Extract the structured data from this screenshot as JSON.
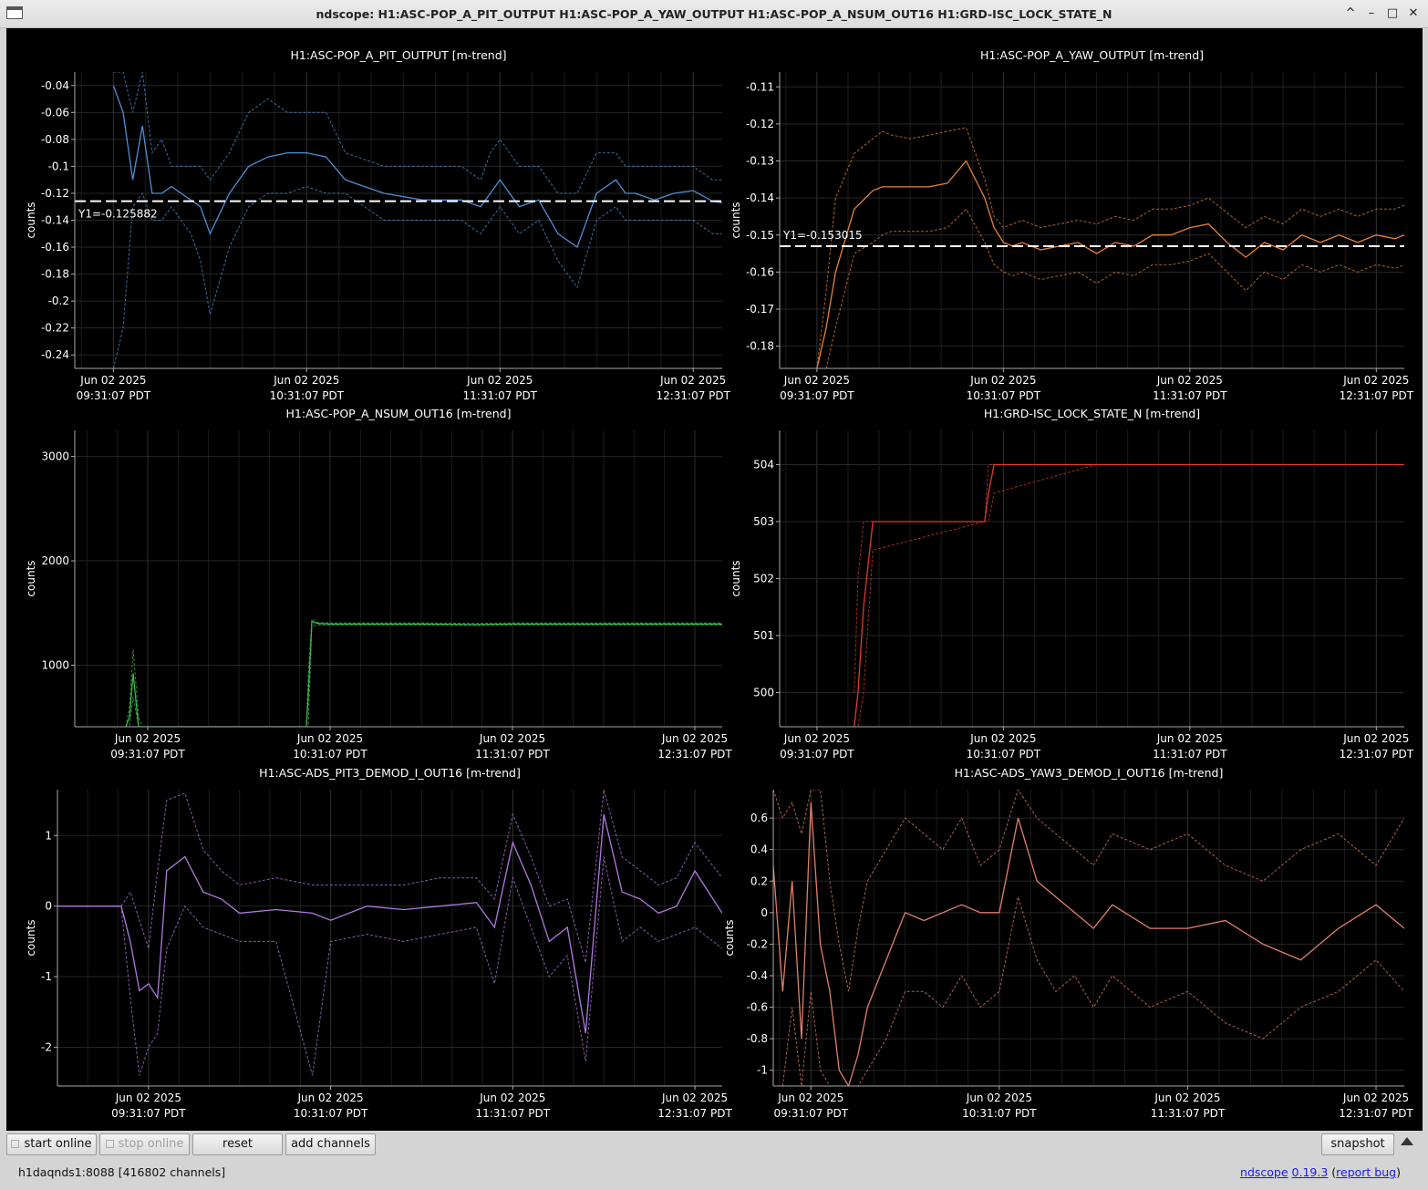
{
  "window": {
    "title": "ndscope: H1:ASC-POP_A_PIT_OUTPUT H1:ASC-POP_A_YAW_OUTPUT H1:ASC-POP_A_NSUM_OUT16 H1:GRD-ISC_LOCK_STATE_N",
    "controls": [
      "^",
      "–",
      "□",
      "✕"
    ]
  },
  "x_ticks": {
    "date_line": "Jun 02 2025",
    "time_lines": [
      "09:31:07 PDT",
      "10:31:07 PDT",
      "11:31:07 PDT",
      "12:31:07 PDT"
    ]
  },
  "chart_data": [
    {
      "type": "line",
      "title": "H1:ASC-POP_A_PIT_OUTPUT [m-trend]",
      "ylabel": "counts",
      "ylim": [
        -0.25,
        -0.03
      ],
      "yticks": [
        -0.04,
        -0.06,
        -0.08,
        -0.1,
        -0.12,
        -0.14,
        -0.16,
        -0.18,
        -0.2,
        -0.22,
        -0.24
      ],
      "xlim": [
        -0.2,
        3.15
      ],
      "color": "#4f8fd6",
      "cursor": {
        "y": -0.125882,
        "label": "Y1=-0.125882"
      },
      "x": [
        0,
        0.05,
        0.1,
        0.15,
        0.2,
        0.25,
        0.3,
        0.35,
        0.4,
        0.45,
        0.5,
        0.6,
        0.7,
        0.8,
        0.9,
        1.0,
        1.1,
        1.2,
        1.4,
        1.6,
        1.8,
        1.9,
        1.95,
        2.0,
        2.1,
        2.2,
        2.3,
        2.4,
        2.5,
        2.6,
        2.65,
        2.7,
        2.8,
        2.9,
        3.0,
        3.1,
        3.15
      ],
      "mean": [
        -0.04,
        -0.06,
        -0.11,
        -0.07,
        -0.12,
        -0.12,
        -0.115,
        -0.12,
        -0.125,
        -0.13,
        -0.15,
        -0.12,
        -0.1,
        -0.093,
        -0.09,
        -0.09,
        -0.093,
        -0.11,
        -0.12,
        -0.125,
        -0.125,
        -0.13,
        -0.12,
        -0.11,
        -0.13,
        -0.125,
        -0.15,
        -0.16,
        -0.12,
        -0.11,
        -0.12,
        -0.12,
        -0.125,
        -0.12,
        -0.118,
        -0.126,
        -0.127
      ],
      "max": [
        -0.03,
        -0.03,
        -0.06,
        -0.03,
        -0.09,
        -0.08,
        -0.1,
        -0.1,
        -0.1,
        -0.1,
        -0.11,
        -0.09,
        -0.06,
        -0.05,
        -0.06,
        -0.06,
        -0.06,
        -0.09,
        -0.1,
        -0.1,
        -0.1,
        -0.11,
        -0.09,
        -0.08,
        -0.1,
        -0.1,
        -0.12,
        -0.12,
        -0.09,
        -0.09,
        -0.1,
        -0.1,
        -0.1,
        -0.1,
        -0.1,
        -0.11,
        -0.11
      ],
      "min": [
        -0.25,
        -0.22,
        -0.13,
        -0.12,
        -0.14,
        -0.14,
        -0.13,
        -0.14,
        -0.15,
        -0.17,
        -0.21,
        -0.16,
        -0.13,
        -0.12,
        -0.12,
        -0.115,
        -0.12,
        -0.12,
        -0.14,
        -0.14,
        -0.14,
        -0.15,
        -0.14,
        -0.13,
        -0.15,
        -0.14,
        -0.17,
        -0.19,
        -0.14,
        -0.13,
        -0.14,
        -0.14,
        -0.14,
        -0.14,
        -0.14,
        -0.15,
        -0.15
      ]
    },
    {
      "type": "line",
      "title": "H1:ASC-POP_A_YAW_OUTPUT [m-trend]",
      "ylabel": "counts",
      "ylim": [
        -0.186,
        -0.106
      ],
      "yticks": [
        -0.11,
        -0.12,
        -0.13,
        -0.14,
        -0.15,
        -0.16,
        -0.17,
        -0.18
      ],
      "xlim": [
        -0.2,
        3.15
      ],
      "color": "#e8813a",
      "cursor": {
        "y": -0.153015,
        "label": "Y1=-0.153015"
      },
      "x": [
        0,
        0.05,
        0.1,
        0.2,
        0.3,
        0.35,
        0.4,
        0.5,
        0.6,
        0.7,
        0.8,
        0.9,
        0.95,
        1.0,
        1.05,
        1.1,
        1.2,
        1.3,
        1.4,
        1.5,
        1.6,
        1.7,
        1.8,
        1.9,
        2.0,
        2.1,
        2.2,
        2.3,
        2.4,
        2.5,
        2.6,
        2.7,
        2.8,
        2.9,
        3.0,
        3.1,
        3.15
      ],
      "mean": [
        -0.186,
        -0.175,
        -0.16,
        -0.143,
        -0.138,
        -0.137,
        -0.137,
        -0.137,
        -0.137,
        -0.136,
        -0.13,
        -0.14,
        -0.148,
        -0.152,
        -0.153,
        -0.152,
        -0.154,
        -0.153,
        -0.152,
        -0.155,
        -0.152,
        -0.153,
        -0.15,
        -0.15,
        -0.148,
        -0.147,
        -0.152,
        -0.156,
        -0.152,
        -0.154,
        -0.15,
        -0.152,
        -0.15,
        -0.152,
        -0.15,
        -0.151,
        -0.15
      ],
      "max": [
        -0.186,
        -0.165,
        -0.14,
        -0.128,
        -0.124,
        -0.122,
        -0.123,
        -0.124,
        -0.123,
        -0.122,
        -0.121,
        -0.135,
        -0.145,
        -0.148,
        -0.147,
        -0.146,
        -0.148,
        -0.147,
        -0.146,
        -0.147,
        -0.145,
        -0.146,
        -0.143,
        -0.143,
        -0.142,
        -0.14,
        -0.144,
        -0.148,
        -0.145,
        -0.147,
        -0.143,
        -0.145,
        -0.143,
        -0.145,
        -0.143,
        -0.143,
        -0.142
      ],
      "min": [
        -0.186,
        -0.186,
        -0.175,
        -0.155,
        -0.152,
        -0.15,
        -0.149,
        -0.149,
        -0.149,
        -0.148,
        -0.143,
        -0.152,
        -0.158,
        -0.16,
        -0.161,
        -0.16,
        -0.162,
        -0.161,
        -0.16,
        -0.163,
        -0.16,
        -0.161,
        -0.158,
        -0.158,
        -0.157,
        -0.155,
        -0.16,
        -0.165,
        -0.16,
        -0.162,
        -0.158,
        -0.16,
        -0.158,
        -0.16,
        -0.158,
        -0.159,
        -0.158
      ]
    },
    {
      "type": "line",
      "title": "H1:ASC-POP_A_NSUM_OUT16 [m-trend]",
      "ylabel": "counts",
      "ylim": [
        410,
        3250
      ],
      "yticks": [
        1000,
        2000,
        3000
      ],
      "xlim": [
        -0.4,
        3.15
      ],
      "color": "#3fb34f",
      "x": [
        -0.12,
        -0.1,
        -0.08,
        -0.05,
        -0.03,
        0.87,
        0.88,
        0.9,
        0.93,
        1.0,
        1.2,
        1.5,
        1.8,
        2.0,
        2.3,
        2.6,
        2.9,
        3.15
      ],
      "mean": [
        410,
        500,
        920,
        410,
        410,
        410,
        700,
        1420,
        1400,
        1395,
        1395,
        1395,
        1390,
        1395,
        1395,
        1395,
        1395,
        1395
      ],
      "max": [
        410,
        600,
        1150,
        500,
        410,
        410,
        900,
        1440,
        1410,
        1405,
        1405,
        1405,
        1400,
        1405,
        1405,
        1405,
        1405,
        1405
      ],
      "min": [
        410,
        410,
        700,
        410,
        410,
        410,
        410,
        1380,
        1385,
        1385,
        1385,
        1385,
        1380,
        1385,
        1385,
        1385,
        1385,
        1385
      ]
    },
    {
      "type": "line",
      "title": "H1:GRD-ISC_LOCK_STATE_N [m-trend]",
      "ylabel": "counts",
      "ylim": [
        499.4,
        504.6
      ],
      "yticks": [
        500,
        501,
        502,
        503,
        504
      ],
      "xlim": [
        -0.2,
        3.15
      ],
      "color": "#e03a2e",
      "x": [
        0.2,
        0.22,
        0.25,
        0.3,
        0.9,
        0.92,
        0.95,
        1.5,
        2.0,
        2.5,
        3.15
      ],
      "mean": [
        499.4,
        500,
        501.5,
        503,
        503,
        503.5,
        504,
        504,
        504,
        504,
        504
      ],
      "max": [
        500,
        502,
        503,
        503,
        503,
        504,
        504,
        504,
        504,
        504,
        504
      ],
      "min": [
        499.4,
        499.4,
        500,
        502.5,
        503,
        503,
        503.5,
        504,
        504,
        504,
        504
      ]
    },
    {
      "type": "line",
      "title": "H1:ASC-ADS_PIT3_DEMOD_I_OUT16 [m-trend]",
      "ylabel": "counts",
      "ylim": [
        -2.55,
        1.65
      ],
      "yticks": [
        1,
        0,
        -1,
        -2
      ],
      "xlim": [
        -0.5,
        3.15
      ],
      "color": "#b07ae0",
      "x": [
        -0.5,
        -0.15,
        -0.1,
        -0.05,
        0,
        0.05,
        0.1,
        0.2,
        0.3,
        0.4,
        0.5,
        0.7,
        0.9,
        1.0,
        1.2,
        1.4,
        1.6,
        1.8,
        1.9,
        2.0,
        2.1,
        2.2,
        2.3,
        2.4,
        2.5,
        2.6,
        2.7,
        2.8,
        2.9,
        3.0,
        3.15
      ],
      "mean": [
        0,
        0,
        -0.5,
        -1.2,
        -1.1,
        -1.3,
        0.5,
        0.7,
        0.2,
        0.1,
        -0.1,
        -0.05,
        -0.1,
        -0.2,
        0,
        -0.05,
        0,
        0.05,
        -0.3,
        0.9,
        0.3,
        -0.5,
        -0.3,
        -1.8,
        1.3,
        0.2,
        0.1,
        -0.1,
        0,
        0.5,
        -0.1
      ],
      "max": [
        0,
        0,
        0.2,
        -0.2,
        -0.6,
        0.5,
        1.5,
        1.6,
        0.8,
        0.5,
        0.3,
        0.4,
        0.3,
        0.3,
        0.3,
        0.3,
        0.4,
        0.4,
        0.1,
        1.3,
        0.7,
        0,
        0.1,
        -0.8,
        1.65,
        0.7,
        0.5,
        0.3,
        0.4,
        0.9,
        0.4
      ],
      "min": [
        0,
        0,
        -1.3,
        -2.4,
        -2,
        -1.8,
        -0.6,
        0,
        -0.3,
        -0.4,
        -0.5,
        -0.5,
        -2.4,
        -0.5,
        -0.4,
        -0.5,
        -0.4,
        -0.3,
        -1.1,
        0.4,
        -0.3,
        -1,
        -0.7,
        -2.2,
        0.7,
        -0.5,
        -0.3,
        -0.5,
        -0.4,
        -0.3,
        -0.6
      ]
    },
    {
      "type": "line",
      "title": "H1:ASC-ADS_YAW3_DEMOD_I_OUT16 [m-trend]",
      "ylabel": "counts",
      "ylim": [
        -1.1,
        0.78
      ],
      "yticks": [
        0.6,
        0.4,
        0.2,
        0,
        -0.2,
        -0.4,
        -0.6,
        -0.8,
        -1
      ],
      "xlim": [
        -0.2,
        3.15
      ],
      "color": "#e0806a",
      "x": [
        -0.2,
        -0.15,
        -0.1,
        -0.05,
        0,
        0.05,
        0.1,
        0.15,
        0.2,
        0.25,
        0.3,
        0.4,
        0.5,
        0.6,
        0.7,
        0.8,
        0.9,
        1.0,
        1.1,
        1.2,
        1.3,
        1.4,
        1.5,
        1.6,
        1.8,
        2.0,
        2.2,
        2.4,
        2.6,
        2.8,
        3.0,
        3.15
      ],
      "mean": [
        0.3,
        -0.5,
        0.2,
        -0.8,
        0.7,
        -0.2,
        -0.5,
        -1.0,
        -1.1,
        -0.9,
        -0.6,
        -0.3,
        0,
        -0.05,
        0,
        0.05,
        0,
        0,
        0.6,
        0.2,
        0.1,
        0,
        -0.1,
        0.05,
        -0.1,
        -0.1,
        -0.05,
        -0.2,
        -0.3,
        -0.1,
        0.05,
        -0.1
      ],
      "max": [
        0.78,
        0.6,
        0.7,
        0.5,
        0.78,
        0.78,
        0.2,
        -0.2,
        -0.5,
        -0.1,
        0.2,
        0.4,
        0.6,
        0.5,
        0.4,
        0.6,
        0.3,
        0.4,
        0.78,
        0.6,
        0.5,
        0.4,
        0.3,
        0.5,
        0.4,
        0.5,
        0.3,
        0.2,
        0.4,
        0.5,
        0.3,
        0.6
      ],
      "min": [
        -1.1,
        -1.1,
        -0.6,
        -1.1,
        -0.5,
        -1.0,
        -1.1,
        -1.1,
        -1.1,
        -1.1,
        -1.0,
        -0.8,
        -0.5,
        -0.5,
        -0.6,
        -0.4,
        -0.6,
        -0.5,
        0.1,
        -0.3,
        -0.5,
        -0.4,
        -0.6,
        -0.4,
        -0.6,
        -0.5,
        -0.7,
        -0.8,
        -0.6,
        -0.5,
        -0.3,
        -0.5
      ]
    }
  ],
  "toolbar": {
    "start_online": "start online",
    "stop_online": "stop online",
    "reset": "reset",
    "add_channels": "add channels",
    "snapshot": "snapshot"
  },
  "status": {
    "server": "h1daqnds1:8088  [416802 channels]",
    "app_link": "ndscope",
    "version": "0.19.3",
    "report_bug": "report bug"
  }
}
